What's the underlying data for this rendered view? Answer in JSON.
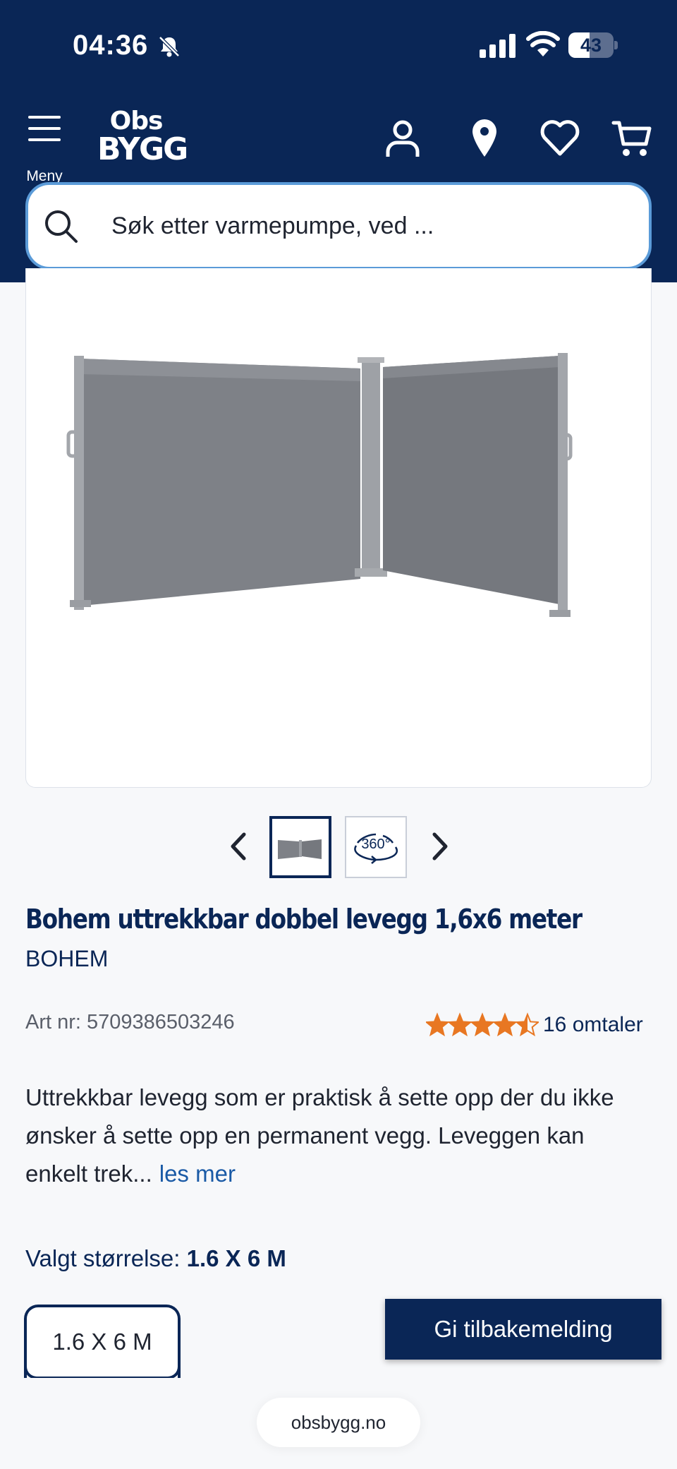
{
  "status_bar": {
    "time": "04:36",
    "battery_level": "43",
    "icons": [
      "bell-slash-icon",
      "cellular-signal-icon",
      "wifi-icon",
      "battery-icon"
    ]
  },
  "header": {
    "menu_label": "Meny",
    "logo_line1": "Obs",
    "logo_line2": "BYGG",
    "icons": [
      "account-icon",
      "store-location-icon",
      "favorites-heart-icon",
      "cart-icon"
    ],
    "background_color": "#0a2656"
  },
  "search": {
    "placeholder": "Søk etter varmepumpe, ved ..."
  },
  "gallery": {
    "thumbnails": [
      "product-photo",
      "360-view"
    ],
    "thumbnail_360_label": "360°"
  },
  "product": {
    "title": "Bohem uttrekkbar dobbel levegg 1,6x6 meter",
    "brand": "BOHEM",
    "art_nr": "Art nr: 5709386503246",
    "rating_value": 4.5,
    "rating_max": 5,
    "reviews": "16 omtaler",
    "description": "Uttrekkbar levegg som er praktisk å sette opp der du ikke ønsker å sette opp en permanent vegg. Leveggen kan enkelt trek...",
    "read_more": "les mer",
    "accent_color": "#e87722"
  },
  "size": {
    "label": "Valgt størrelse:",
    "selected": "1.6 X 6 M",
    "options": [
      "1.6 X 6 M"
    ]
  },
  "feedback_button": "Gi tilbakemelding",
  "browser": {
    "url": "obsbygg.no"
  }
}
